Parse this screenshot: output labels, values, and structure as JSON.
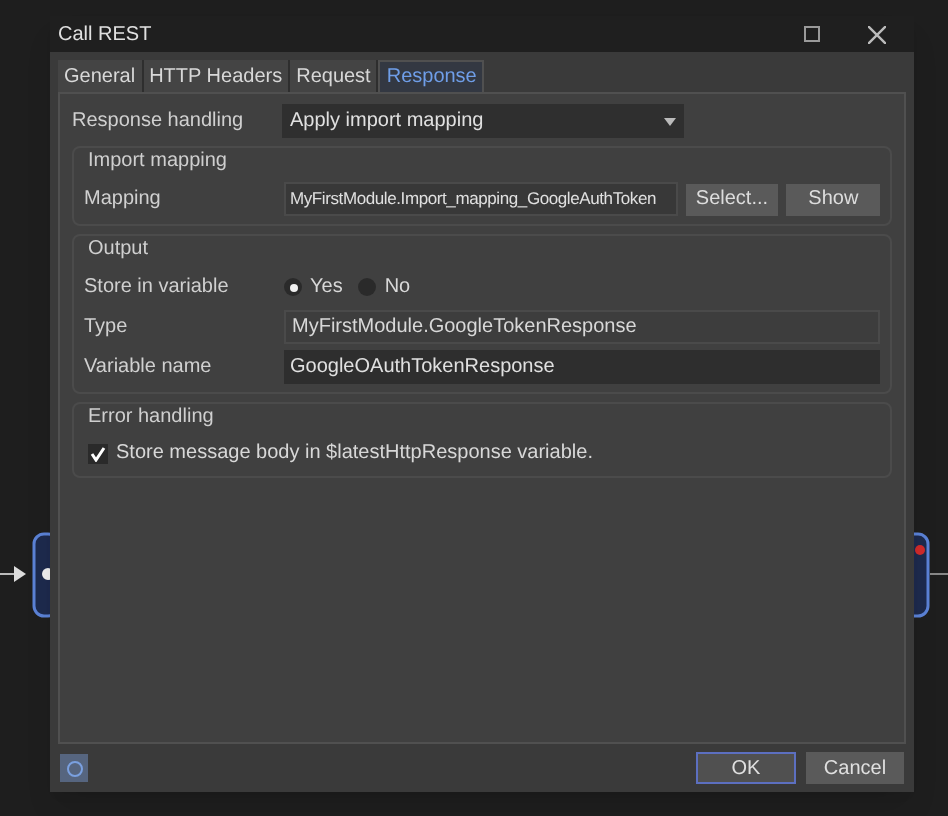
{
  "window": {
    "title": "Call REST"
  },
  "tabs": [
    {
      "label": "General",
      "selected": false
    },
    {
      "label": "HTTP Headers",
      "selected": false
    },
    {
      "label": "Request",
      "selected": false
    },
    {
      "label": "Response",
      "selected": true
    }
  ],
  "response_handling": {
    "label": "Response handling",
    "value": "Apply import mapping"
  },
  "import_mapping": {
    "title": "Import mapping",
    "label": "Mapping",
    "value": "MyFirstModule.Import_mapping_GoogleAuthToken",
    "buttons": [
      "Select...",
      "Show"
    ]
  },
  "output": {
    "title": "Output",
    "store_in_variable": {
      "label": "Store in variable",
      "options": [
        {
          "label": "Yes",
          "selected": true
        },
        {
          "label": "No",
          "selected": false
        }
      ]
    },
    "type": {
      "label": "Type",
      "value": "MyFirstModule.GoogleTokenResponse"
    },
    "variable_name": {
      "label": "Variable name",
      "value": "GoogleOAuthTokenResponse"
    }
  },
  "error_handling": {
    "title": "Error handling",
    "option": {
      "label": "Store message body in $latestHttpResponse variable.",
      "checked": true
    }
  },
  "buttons": [
    {
      "label": "OK",
      "default": true
    },
    {
      "label": "Cancel",
      "default": false
    }
  ]
}
